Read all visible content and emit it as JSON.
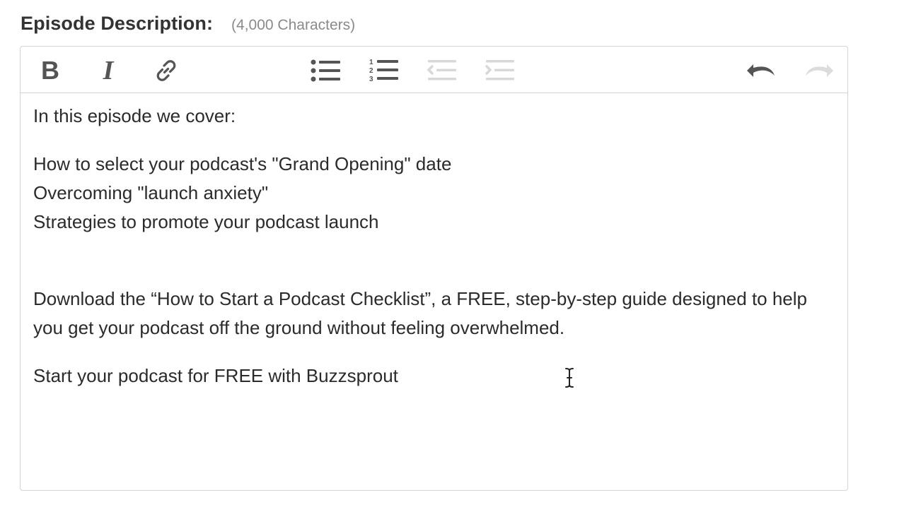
{
  "field": {
    "label": "Episode Description:",
    "hint": "(4,000 Characters)"
  },
  "toolbar": {
    "buttons": [
      {
        "name": "bold",
        "icon": "bold-icon",
        "enabled": true
      },
      {
        "name": "italic",
        "icon": "italic-icon",
        "enabled": true
      },
      {
        "name": "link",
        "icon": "link-icon",
        "enabled": true
      },
      {
        "name": "bulleted-list",
        "icon": "bulleted-list-icon",
        "enabled": true
      },
      {
        "name": "numbered-list",
        "icon": "numbered-list-icon",
        "enabled": true
      },
      {
        "name": "outdent",
        "icon": "outdent-icon",
        "enabled": false
      },
      {
        "name": "indent",
        "icon": "indent-icon",
        "enabled": false
      },
      {
        "name": "undo",
        "icon": "undo-icon",
        "enabled": true
      },
      {
        "name": "redo",
        "icon": "redo-icon",
        "enabled": false
      }
    ],
    "colors": {
      "enabled": "#555555",
      "disabled": "#d8d8d8"
    }
  },
  "editor": {
    "intro": "In this episode we cover:",
    "topics": [
      "How to select your podcast's \"Grand Opening\" date",
      "Overcoming \"launch anxiety\"",
      "Strategies to promote your podcast launch"
    ],
    "download_text": "Download the “How to Start a Podcast Checklist”, a FREE, step-by-step guide designed to help you get your podcast off the ground without feeling overwhelmed.",
    "cta": "Start your podcast for FREE with Buzzsprout"
  },
  "colors": {
    "border": "#d4d4d4",
    "label": "#333333",
    "hint": "#8a8a8a",
    "text": "#2b2b2b"
  }
}
